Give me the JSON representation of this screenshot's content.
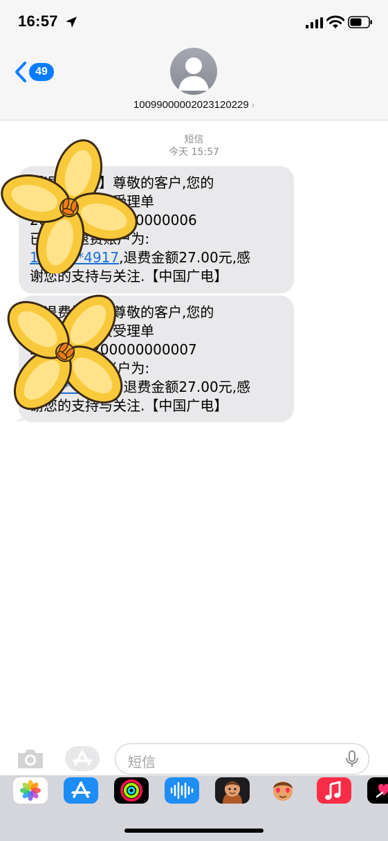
{
  "status_bar": {
    "time": "16:57"
  },
  "nav": {
    "back_count": "49",
    "contact_name": "10099000002023120229",
    "contact_chevron": "›"
  },
  "conversation": {
    "service_label": "短信",
    "timestamp": "今天 15:57",
    "messages": [
      {
        "line1": "【退费提醒】尊敬的客户,您的",
        "line2": "宽带账户退费受理单",
        "line3": "2023120200000000006",
        "line4": "已受理,退费账户为:",
        "link": "198****4917",
        "line5": ",退费金额27.00元,感",
        "line6": "谢您的支持与关注.【中国广电】"
      },
      {
        "line1": "【退费提醒】尊敬的客户,您的",
        "line2": "宽带账户退费受理单",
        "line3": "2023120200000000007",
        "line4": "已受理,退费账户为:",
        "link": "198****4917",
        "line5": ",退费金额27.00元,感",
        "line6": "谢您的支持与关注.【中国广电】"
      }
    ]
  },
  "input": {
    "placeholder": "短信"
  },
  "app_drawer": {
    "apps": [
      "photos-icon",
      "app-store-icon",
      "activity-icon",
      "audio-message-icon",
      "memoji-icon",
      "animoji-icon",
      "music-icon",
      "digital-touch-icon"
    ]
  },
  "colors": {
    "accent": "#0a7cff",
    "bubble": "#e9e9eb",
    "link": "#1a6fd8",
    "sticker_yellow": "#f8c93a"
  }
}
